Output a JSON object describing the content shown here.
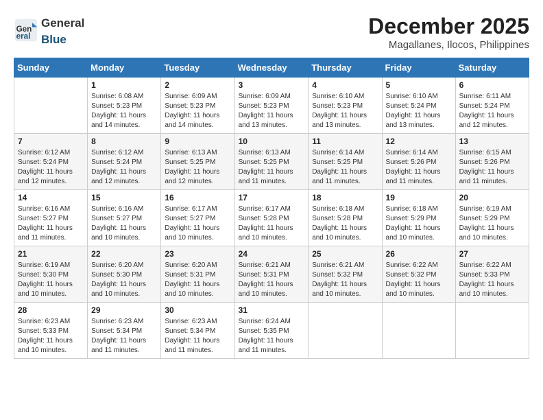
{
  "header": {
    "logo_general": "General",
    "logo_blue": "Blue",
    "month_title": "December 2025",
    "location": "Magallanes, Ilocos, Philippines"
  },
  "weekdays": [
    "Sunday",
    "Monday",
    "Tuesday",
    "Wednesday",
    "Thursday",
    "Friday",
    "Saturday"
  ],
  "weeks": [
    [
      {
        "day": "",
        "info": ""
      },
      {
        "day": "1",
        "info": "Sunrise: 6:08 AM\nSunset: 5:23 PM\nDaylight: 11 hours\nand 14 minutes."
      },
      {
        "day": "2",
        "info": "Sunrise: 6:09 AM\nSunset: 5:23 PM\nDaylight: 11 hours\nand 14 minutes."
      },
      {
        "day": "3",
        "info": "Sunrise: 6:09 AM\nSunset: 5:23 PM\nDaylight: 11 hours\nand 13 minutes."
      },
      {
        "day": "4",
        "info": "Sunrise: 6:10 AM\nSunset: 5:23 PM\nDaylight: 11 hours\nand 13 minutes."
      },
      {
        "day": "5",
        "info": "Sunrise: 6:10 AM\nSunset: 5:24 PM\nDaylight: 11 hours\nand 13 minutes."
      },
      {
        "day": "6",
        "info": "Sunrise: 6:11 AM\nSunset: 5:24 PM\nDaylight: 11 hours\nand 12 minutes."
      }
    ],
    [
      {
        "day": "7",
        "info": "Sunrise: 6:12 AM\nSunset: 5:24 PM\nDaylight: 11 hours\nand 12 minutes."
      },
      {
        "day": "8",
        "info": "Sunrise: 6:12 AM\nSunset: 5:24 PM\nDaylight: 11 hours\nand 12 minutes."
      },
      {
        "day": "9",
        "info": "Sunrise: 6:13 AM\nSunset: 5:25 PM\nDaylight: 11 hours\nand 12 minutes."
      },
      {
        "day": "10",
        "info": "Sunrise: 6:13 AM\nSunset: 5:25 PM\nDaylight: 11 hours\nand 11 minutes."
      },
      {
        "day": "11",
        "info": "Sunrise: 6:14 AM\nSunset: 5:25 PM\nDaylight: 11 hours\nand 11 minutes."
      },
      {
        "day": "12",
        "info": "Sunrise: 6:14 AM\nSunset: 5:26 PM\nDaylight: 11 hours\nand 11 minutes."
      },
      {
        "day": "13",
        "info": "Sunrise: 6:15 AM\nSunset: 5:26 PM\nDaylight: 11 hours\nand 11 minutes."
      }
    ],
    [
      {
        "day": "14",
        "info": "Sunrise: 6:16 AM\nSunset: 5:27 PM\nDaylight: 11 hours\nand 11 minutes."
      },
      {
        "day": "15",
        "info": "Sunrise: 6:16 AM\nSunset: 5:27 PM\nDaylight: 11 hours\nand 10 minutes."
      },
      {
        "day": "16",
        "info": "Sunrise: 6:17 AM\nSunset: 5:27 PM\nDaylight: 11 hours\nand 10 minutes."
      },
      {
        "day": "17",
        "info": "Sunrise: 6:17 AM\nSunset: 5:28 PM\nDaylight: 11 hours\nand 10 minutes."
      },
      {
        "day": "18",
        "info": "Sunrise: 6:18 AM\nSunset: 5:28 PM\nDaylight: 11 hours\nand 10 minutes."
      },
      {
        "day": "19",
        "info": "Sunrise: 6:18 AM\nSunset: 5:29 PM\nDaylight: 11 hours\nand 10 minutes."
      },
      {
        "day": "20",
        "info": "Sunrise: 6:19 AM\nSunset: 5:29 PM\nDaylight: 11 hours\nand 10 minutes."
      }
    ],
    [
      {
        "day": "21",
        "info": "Sunrise: 6:19 AM\nSunset: 5:30 PM\nDaylight: 11 hours\nand 10 minutes."
      },
      {
        "day": "22",
        "info": "Sunrise: 6:20 AM\nSunset: 5:30 PM\nDaylight: 11 hours\nand 10 minutes."
      },
      {
        "day": "23",
        "info": "Sunrise: 6:20 AM\nSunset: 5:31 PM\nDaylight: 11 hours\nand 10 minutes."
      },
      {
        "day": "24",
        "info": "Sunrise: 6:21 AM\nSunset: 5:31 PM\nDaylight: 11 hours\nand 10 minutes."
      },
      {
        "day": "25",
        "info": "Sunrise: 6:21 AM\nSunset: 5:32 PM\nDaylight: 11 hours\nand 10 minutes."
      },
      {
        "day": "26",
        "info": "Sunrise: 6:22 AM\nSunset: 5:32 PM\nDaylight: 11 hours\nand 10 minutes."
      },
      {
        "day": "27",
        "info": "Sunrise: 6:22 AM\nSunset: 5:33 PM\nDaylight: 11 hours\nand 10 minutes."
      }
    ],
    [
      {
        "day": "28",
        "info": "Sunrise: 6:23 AM\nSunset: 5:33 PM\nDaylight: 11 hours\nand 10 minutes."
      },
      {
        "day": "29",
        "info": "Sunrise: 6:23 AM\nSunset: 5:34 PM\nDaylight: 11 hours\nand 11 minutes."
      },
      {
        "day": "30",
        "info": "Sunrise: 6:23 AM\nSunset: 5:34 PM\nDaylight: 11 hours\nand 11 minutes."
      },
      {
        "day": "31",
        "info": "Sunrise: 6:24 AM\nSunset: 5:35 PM\nDaylight: 11 hours\nand 11 minutes."
      },
      {
        "day": "",
        "info": ""
      },
      {
        "day": "",
        "info": ""
      },
      {
        "day": "",
        "info": ""
      }
    ]
  ]
}
